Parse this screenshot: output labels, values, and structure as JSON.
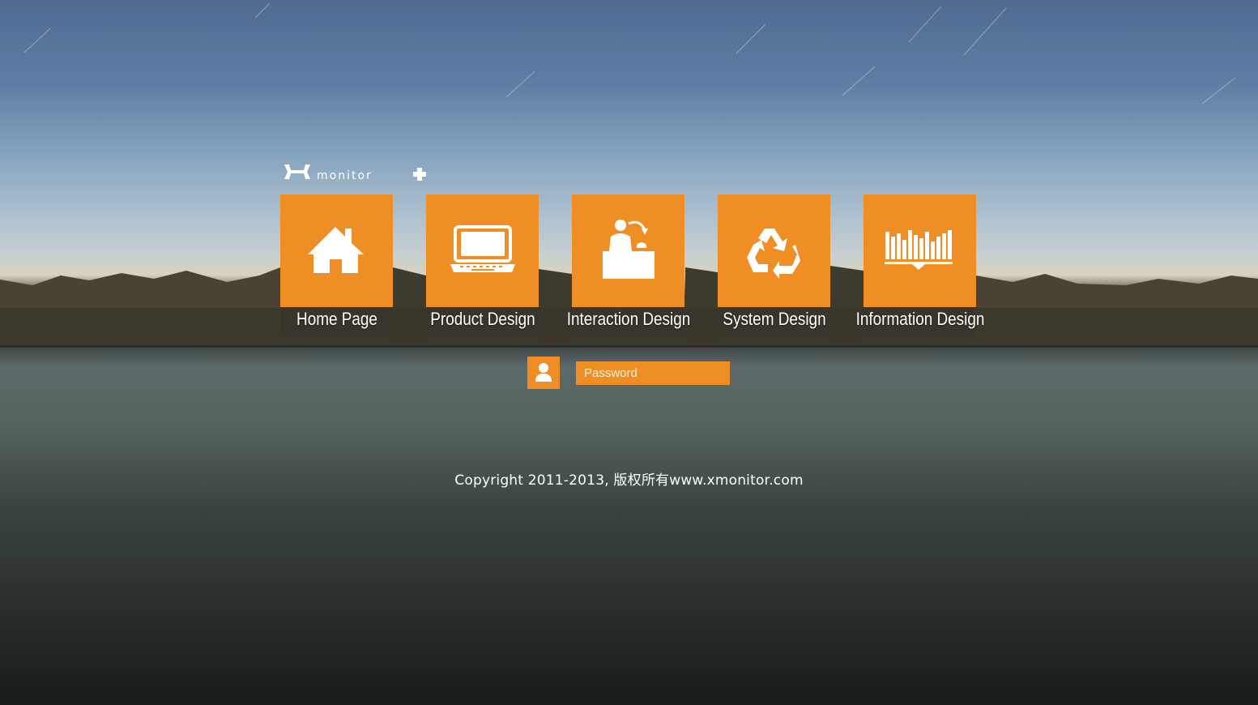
{
  "brand": {
    "logo_text": "monitor",
    "logo_icon": "xmonitor-logo"
  },
  "tiles": [
    {
      "label": "Home Page",
      "icon": "house-icon"
    },
    {
      "label": "Product Design",
      "icon": "laptop-icon"
    },
    {
      "label": "Interaction Design",
      "icon": "service-desk-icon"
    },
    {
      "label": "System Design",
      "icon": "recycle-icon"
    },
    {
      "label": "Information Design",
      "icon": "book-chart-icon"
    }
  ],
  "login": {
    "user_icon": "user-icon",
    "password_placeholder": "Password"
  },
  "footer": {
    "copyright": "Copyright 2011-2013, 版权所有www.xmonitor.com"
  },
  "colors": {
    "accent": "#ee8e24",
    "text": "#ffffff"
  }
}
